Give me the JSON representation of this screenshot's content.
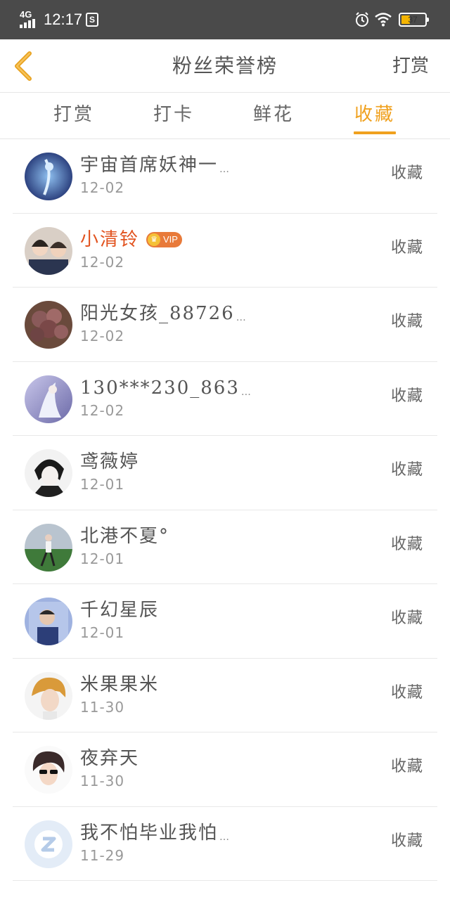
{
  "status_bar": {
    "network": "4G",
    "time": "12:17",
    "app_icon": "S",
    "battery_percent": 37,
    "battery_label": "37"
  },
  "header": {
    "title": "粉丝荣誉榜",
    "action_label": "打赏"
  },
  "tabs": [
    {
      "label": "打赏",
      "active": false
    },
    {
      "label": "打卡",
      "active": false
    },
    {
      "label": "鲜花",
      "active": false
    },
    {
      "label": "收藏",
      "active": true
    }
  ],
  "accent_color": "#f0a11e",
  "list": [
    {
      "name": "宇宙首席妖神一",
      "truncated": true,
      "date": "12-02",
      "action": "收藏",
      "vip": false
    },
    {
      "name": "小清铃",
      "truncated": false,
      "date": "12-02",
      "action": "收藏",
      "vip": true,
      "vip_label": "VIP"
    },
    {
      "name": "阳光女孩_88726",
      "truncated": true,
      "date": "12-02",
      "action": "收藏",
      "vip": false
    },
    {
      "name": "130***230_863",
      "truncated": true,
      "date": "12-02",
      "action": "收藏",
      "vip": false
    },
    {
      "name": "鸢薇婷",
      "truncated": false,
      "date": "12-01",
      "action": "收藏",
      "vip": false
    },
    {
      "name": "北港不夏°",
      "truncated": false,
      "date": "12-01",
      "action": "收藏",
      "vip": false
    },
    {
      "name": "千幻星辰",
      "truncated": false,
      "date": "12-01",
      "action": "收藏",
      "vip": false
    },
    {
      "name": "米果果米",
      "truncated": false,
      "date": "11-30",
      "action": "收藏",
      "vip": false
    },
    {
      "name": "夜弃天",
      "truncated": false,
      "date": "11-30",
      "action": "收藏",
      "vip": false
    },
    {
      "name": "我不怕毕业我怕",
      "truncated": true,
      "date": "11-29",
      "action": "收藏",
      "vip": false
    }
  ],
  "ellipsis": "…"
}
